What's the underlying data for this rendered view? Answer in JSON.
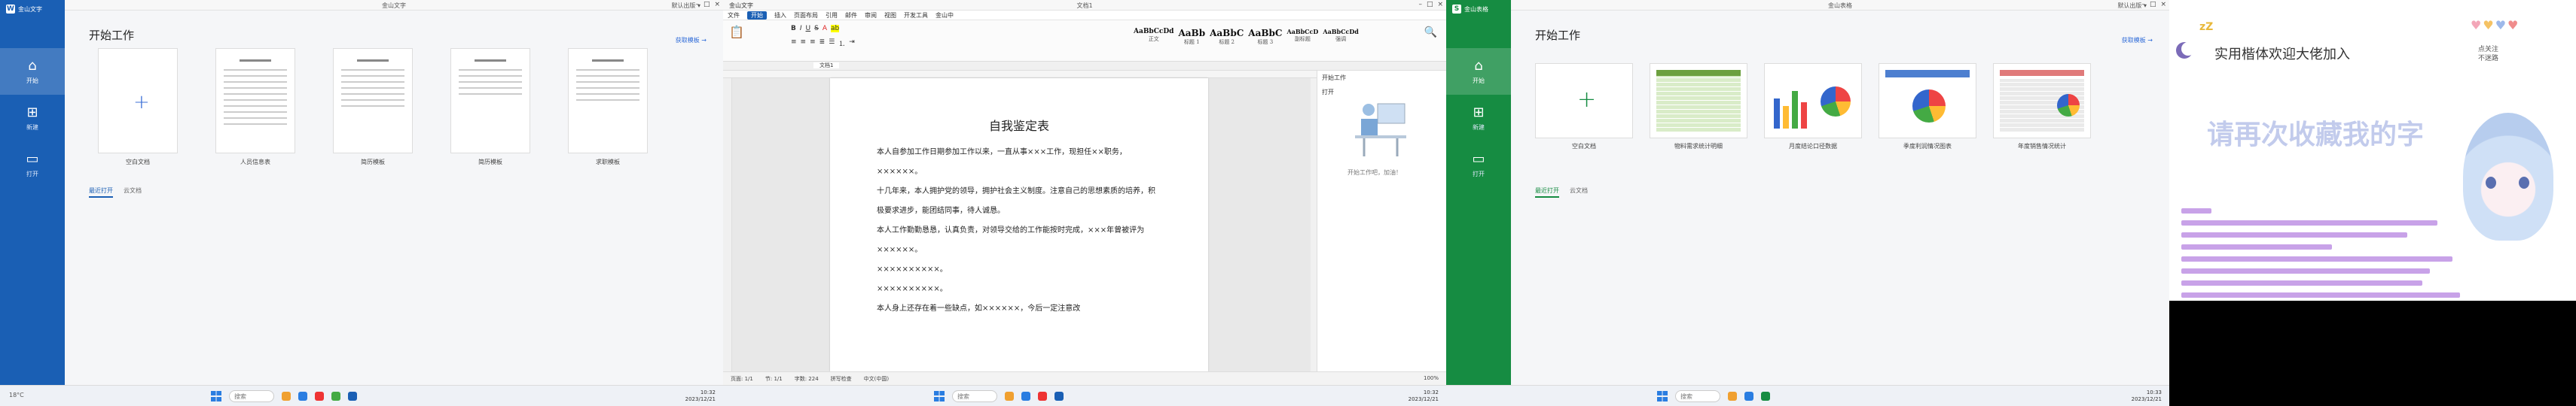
{
  "s1": {
    "title": "金山文字",
    "brand": "金山文字",
    "right_title": "默认出版 ▾",
    "nav": [
      {
        "label": "开始",
        "icon": "home-icon"
      },
      {
        "label": "新建",
        "icon": "new-doc-icon"
      },
      {
        "label": "打开",
        "icon": "folder-icon"
      }
    ],
    "heading": "开始工作",
    "more": "获取模板 →",
    "templates": [
      "空白文档",
      "人员信息表",
      "简历模板",
      "简历模板",
      "求职模板"
    ],
    "tabs": [
      "最近打开",
      "云文档"
    ]
  },
  "s2": {
    "title": "金山文字",
    "doc_name": "文档1",
    "menu": [
      "文件",
      "开始",
      "插入",
      "页面布局",
      "引用",
      "邮件",
      "审阅",
      "视图",
      "开发工具",
      "金山中"
    ],
    "active_menu": "开始",
    "styles": [
      {
        "sample": "AaBbCcDd",
        "name": "正文"
      },
      {
        "sample": "AaBb",
        "name": "标题 1"
      },
      {
        "sample": "AaBbC",
        "name": "标题 2"
      },
      {
        "sample": "AaBbC",
        "name": "标题 3"
      },
      {
        "sample": "AaBbCcD",
        "name": "副标题"
      },
      {
        "sample": "AaBbCcDd",
        "name": "强调"
      }
    ],
    "doc_tab": "文档1",
    "page_title": "自我鉴定表",
    "paragraphs": [
      "本人自参加工作日期参加工作以来，一直从事×××工作，现担任××职务，××××××。",
      "十几年来，本人拥护党的领导，拥护社会主义制度。注意自己的思想素质的培养，积极要求进步，能团结同事，待人诚恳。",
      "本人工作勤勤恳恳，认真负责，对领导交给的工作能按时完成，×××年曾被评为××××××。",
      "××××××××××。",
      "××××××××××。",
      "本人身上还存在着一些缺点，如××××××，今后一定注意改"
    ],
    "panel_title": "开始工作",
    "panel_sub": "打开",
    "panel_empty": "开始工作吧，加油！",
    "status": [
      "页面: 1/1",
      "节: 1/1",
      "字数: 224",
      "拼写检查",
      "中文(中国)",
      "100%"
    ]
  },
  "s3": {
    "title": "金山表格",
    "brand": "金山表格",
    "right_title": "默认出版 ▾",
    "nav": [
      {
        "label": "开始",
        "icon": "home-icon"
      },
      {
        "label": "新建",
        "icon": "new-doc-icon"
      },
      {
        "label": "打开",
        "icon": "folder-icon"
      }
    ],
    "heading": "开始工作",
    "more": "获取模板 →",
    "templates": [
      "空白文档",
      "物料需求统计明细",
      "月度结论口径数据",
      "季度利润情况图表",
      "年度销售情况统计"
    ],
    "tabs": [
      "最近打开",
      "云文档"
    ]
  },
  "s4": {
    "slogan": "实用楷体欢迎大佬加入",
    "handnote": "点关注\n不迷路",
    "big_title": "请再次收藏我的字"
  },
  "taskbar": {
    "search": "搜索",
    "weather": "18°C",
    "time1": "10:32",
    "date1": "2023/12/21",
    "time2": "10:32",
    "date2": "2023/12/21",
    "time3": "10:33",
    "date3": "2023/12/21"
  },
  "colors": {
    "writer_blue": "#1a5fb4",
    "sheet_green": "#168c42"
  }
}
